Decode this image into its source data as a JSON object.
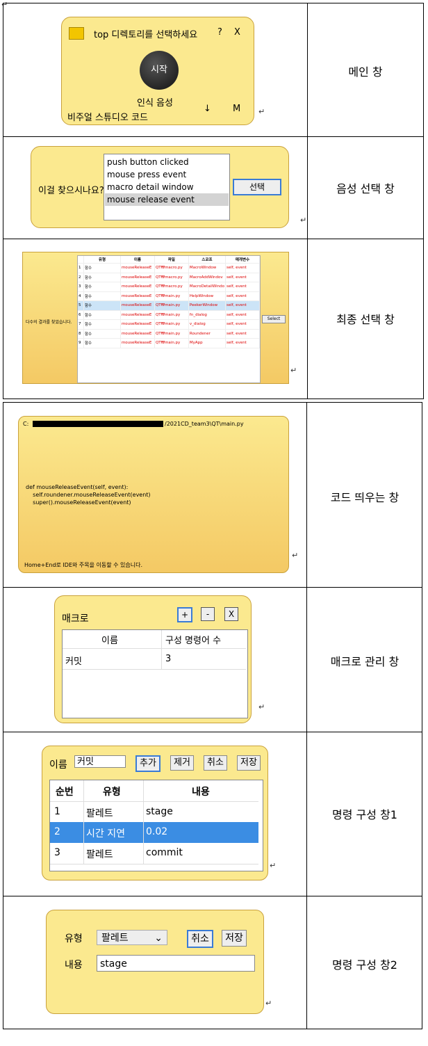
{
  "rows": [
    {
      "description": "메인 창"
    },
    {
      "description": "음성 선택 창"
    },
    {
      "description": "최종 선택 창"
    },
    {
      "description": "코드 띄우는 창"
    },
    {
      "description": "매크로 관리 창"
    },
    {
      "description": "명령 구성 창1"
    },
    {
      "description": "명령 구성 창2"
    }
  ],
  "main_window": {
    "title": "top 디렉토리를 선택하세요",
    "help": "?",
    "close": "X",
    "start_label": "시작",
    "status": "인식 음성",
    "arrow": "↓",
    "m_label": "M",
    "app_name": "비주얼 스튜디오 코드"
  },
  "voice_select": {
    "prompt": "이걸 찾으시나요?",
    "options": [
      "push button clicked",
      "mouse press event",
      "macro detail window",
      "mouse release event"
    ],
    "select_label": "선택"
  },
  "final_select": {
    "label": "다수의 결과를 찾았습니다.",
    "select_label": "Select",
    "headers": [
      "유형",
      "이름",
      "파일",
      "스코프",
      "매개변수"
    ],
    "rows": [
      [
        "1",
        "함수",
        "mouseReleaseE",
        "QT₩macro.py",
        "MacroWindow",
        "self, event"
      ],
      [
        "2",
        "함수",
        "mouseReleaseE",
        "QT₩macro.py",
        "MacroAddWindov",
        "self, event"
      ],
      [
        "3",
        "함수",
        "mouseReleaseE",
        "QT₩macro.py",
        "MacroDetailWindo",
        "self, event"
      ],
      [
        "4",
        "함수",
        "mouseReleaseE",
        "QT₩main.py",
        "HelpWindow",
        "self, event"
      ],
      [
        "5",
        "함수",
        "mouseReleaseE",
        "QT₩main.py",
        "PeekerWindow",
        "self, event"
      ],
      [
        "6",
        "함수",
        "mouseReleaseE",
        "QT₩main.py",
        "fn_dialog",
        "self, event"
      ],
      [
        "7",
        "함수",
        "mouseReleaseE",
        "QT₩main.py",
        "v_dialog",
        "self, event"
      ],
      [
        "8",
        "함수",
        "mouseReleaseE",
        "QT₩main.py",
        "Roundener",
        "self, event"
      ],
      [
        "9",
        "함수",
        "mouseReleaseE",
        "QT₩main.py",
        "MyApp",
        "self, event"
      ]
    ]
  },
  "code_window": {
    "path_prefix": "C:",
    "path_suffix": "/2021CD_team3\\QT\\main.py",
    "code": "def mouseReleaseEvent(self, event):\n    self.roundener.mouseReleaseEvent(event)\n    super().mouseReleaseEvent(event)",
    "hint": "Home+End로 IDE와 주목을 이동할 수 있습니다."
  },
  "macro_manage": {
    "title": "매크로",
    "add": "+",
    "remove": "-",
    "close": "X",
    "headers": [
      "이름",
      "구성 명령어 수"
    ],
    "rows": [
      [
        "커밋",
        "3"
      ]
    ]
  },
  "command_config1": {
    "name_label": "이름",
    "name_value": "커밋",
    "buttons": [
      "추가",
      "제거",
      "취소",
      "저장"
    ],
    "headers": [
      "순번",
      "유형",
      "내용"
    ],
    "rows": [
      [
        "1",
        "팔레트",
        "stage"
      ],
      [
        "2",
        "시간 지연",
        "0.02"
      ],
      [
        "3",
        "팔레트",
        "commit"
      ]
    ]
  },
  "command_config2": {
    "type_label": "유형",
    "type_value": "팔레트",
    "cancel": "취소",
    "save": "저장",
    "content_label": "내용",
    "content_value": "stage"
  },
  "paragraph_mark": "↵"
}
